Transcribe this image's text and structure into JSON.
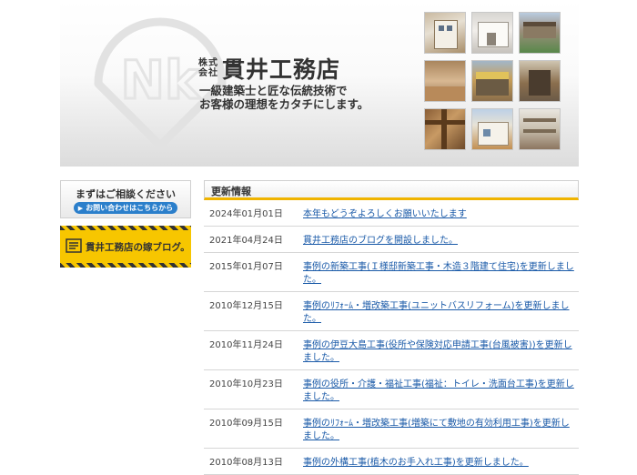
{
  "header": {
    "brand_prefix_1": "株式",
    "brand_prefix_2": "会社",
    "brand_name": "貫井工務店",
    "tagline_1": "一級建築士と匠な伝統技術で",
    "tagline_2": "お客様の理想をカタチにします。",
    "logo_letters": "Nk"
  },
  "sidebar": {
    "consult_title": "まずはご相談ください",
    "consult_cta": "お問い合わせはこちらから",
    "blog_label": "貫井工務店の嫁ブログ。"
  },
  "news": {
    "heading": "更新情報",
    "items": [
      {
        "date": "2024年01月01日",
        "title": "本年もどうぞよろしくお願いいたします"
      },
      {
        "date": "2021年04月24日",
        "title": "貫井工務店のブログを開設しました。"
      },
      {
        "date": "2015年01月07日",
        "title": "事例の新築工事(Ｉ様邸新築工事・木造３階建て住宅)を更新しました。"
      },
      {
        "date": "2010年12月15日",
        "title": "事例のﾘﾌｫｰﾑ・増改築工事(ユニットバスリフォーム)を更新しました。"
      },
      {
        "date": "2010年11月24日",
        "title": "事例の伊豆大島工事(役所や保険対応申請工事(台風被害))を更新しました。"
      },
      {
        "date": "2010年10月23日",
        "title": "事例の役所・介護・福祉工事(福祉：トイレ・洗面台工事)を更新しました。"
      },
      {
        "date": "2010年09月15日",
        "title": "事例のﾘﾌｫｰﾑ・増改築工事(増築にて敷地の有効利用工事)を更新しました。"
      },
      {
        "date": "2010年08月13日",
        "title": "事例の外構工事(植木のお手入れ工事)を更新しました。"
      }
    ]
  },
  "colors": {
    "accent_yellow": "#f7c600",
    "heading_underline": "#f0b400",
    "cta_blue": "#2b7fcb",
    "link_blue": "#1a5aa8"
  },
  "icons": [
    "nk-logo-icon",
    "arrow-right-icon",
    "blog-book-icon"
  ]
}
